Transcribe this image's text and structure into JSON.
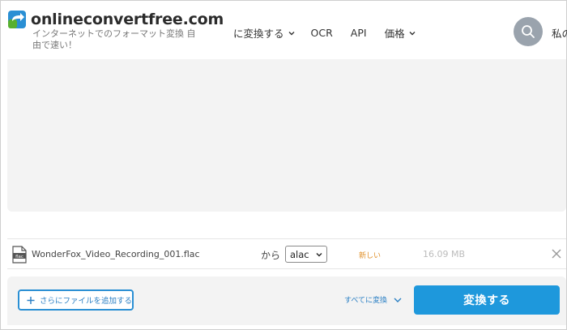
{
  "header": {
    "brand": "onlineconvertfree.com",
    "tagline": "インターネットでのフォーマット変換 自由で速い！",
    "nav": [
      {
        "label": "に変換する",
        "has_dropdown": true
      },
      {
        "label": "OCR",
        "has_dropdown": false
      },
      {
        "label": "API",
        "has_dropdown": false
      },
      {
        "label": "価格",
        "has_dropdown": true
      }
    ],
    "account_label": "私の"
  },
  "file": {
    "name": "WonderFox_Video_Recording_001.flac",
    "icon_label": "flac",
    "from_label": "から",
    "target_format": "alac",
    "status": "新しい",
    "size": "16.09 MB"
  },
  "actions": {
    "add_file": "さらにファイルを追加する",
    "convert_all": "すべてに変換",
    "convert": "変換する"
  },
  "colors": {
    "accent": "#1e98dc",
    "status": "#e0902a",
    "search_button": "#9aa3ad",
    "panel_bg": "#f3f3f3"
  }
}
